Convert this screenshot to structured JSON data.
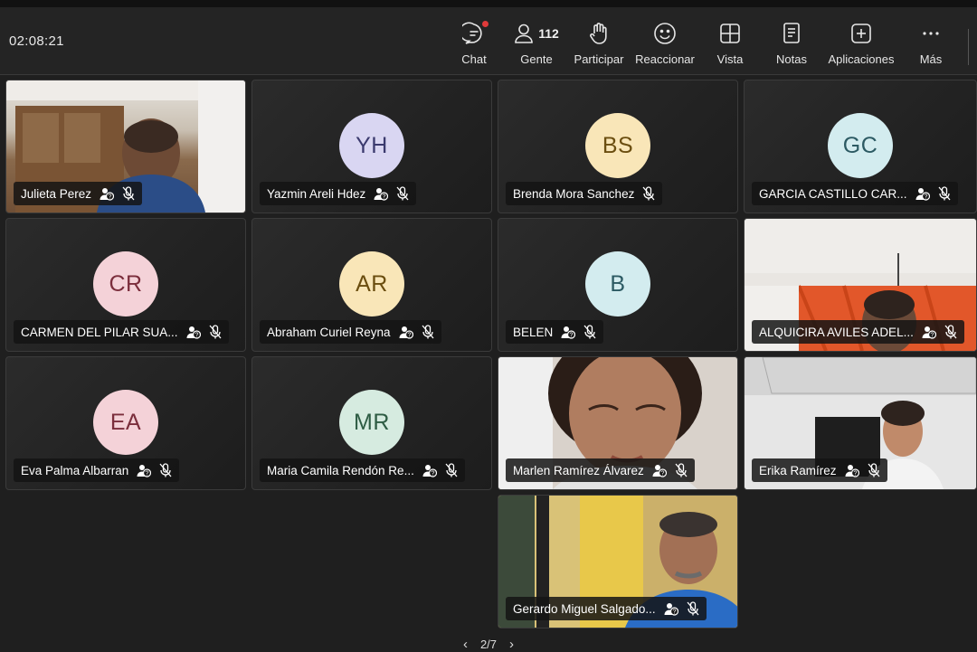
{
  "clock": "02:08:21",
  "toolbar": {
    "chat": "Chat",
    "people": "Gente",
    "people_count": "112",
    "raise": "Participar",
    "react": "Reaccionar",
    "view": "Vista",
    "notes": "Notas",
    "apps": "Aplicaciones",
    "more": "Más"
  },
  "participants": [
    {
      "name": "Julieta Perez",
      "video": true
    },
    {
      "name": "Yazmin Areli Hdez",
      "initials": "YH",
      "avatar_color": "#d9d6f2",
      "text_color": "#3b3a6e"
    },
    {
      "name": "Brenda Mora Sanchez",
      "initials": "BS",
      "avatar_color": "#f9e6b8",
      "text_color": "#6b4e10"
    },
    {
      "name": "GARCIA CASTILLO CAR...",
      "initials": "GC",
      "avatar_color": "#d3ecef",
      "text_color": "#2c5a63"
    },
    {
      "name": "CARMEN DEL PILAR SUA...",
      "initials": "CR",
      "avatar_color": "#f4d2d8",
      "text_color": "#7b2e3c"
    },
    {
      "name": "Abraham Curiel Reyna",
      "initials": "AR",
      "avatar_color": "#f9e6b8",
      "text_color": "#6b4e10"
    },
    {
      "name": "BELEN",
      "initials": "B",
      "avatar_color": "#d3ecef",
      "text_color": "#2c5a63"
    },
    {
      "name": "ALQUICIRA AVILES ADEL...",
      "video": true
    },
    {
      "name": "Eva Palma Albarran",
      "initials": "EA",
      "avatar_color": "#f4d2d8",
      "text_color": "#7b2e3c"
    },
    {
      "name": "Maria Camila Rendón Re...",
      "initials": "MR",
      "avatar_color": "#d6ebe0",
      "text_color": "#2e5c44"
    },
    {
      "name": "Marlen Ramírez Álvarez",
      "video": true
    },
    {
      "name": "Erika Ramírez",
      "video": true
    },
    {
      "name": "Gerardo Miguel Salgado...",
      "video": true
    }
  ],
  "pager": {
    "label": "2/7"
  }
}
